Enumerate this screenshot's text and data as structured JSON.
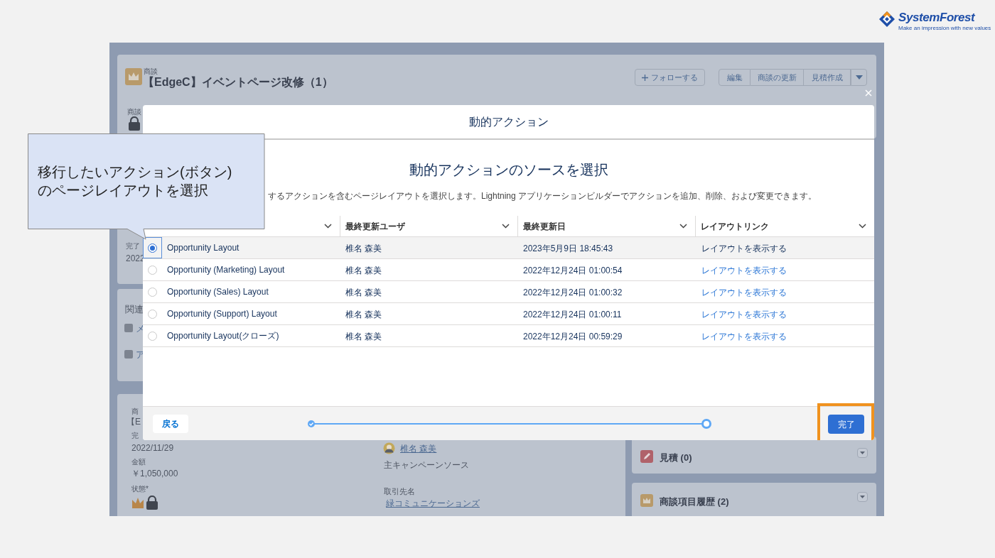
{
  "logo": {
    "name": "SystemForest",
    "tagline": "Make an impression with new values"
  },
  "background_page": {
    "object_label": "商談",
    "record_title": "【EdgeC】イベントページ改修（1）",
    "follow_button": "フォローする",
    "actions": [
      "編集",
      "商談の更新",
      "見積作成"
    ],
    "fragments": [
      "商談",
      "完了",
      "2022",
      "関連",
      "メ",
      "ア",
      "商",
      "【E",
      "完"
    ],
    "fields": [
      {
        "value": "2022/11/29"
      },
      {
        "label": "金額",
        "value": "￥1,050,000"
      },
      {
        "label": "状態*"
      }
    ],
    "owner": "椎名 森美",
    "campaign_label": "主キャンペーンソース",
    "account_label": "取引先名",
    "account": "緑コミュニケーションズ",
    "related": [
      "見積 (0)",
      "商談項目履歴 (2)"
    ]
  },
  "modal": {
    "title": "動的アクション",
    "heading": "動的アクションのソースを選択",
    "description": "するアクションを含むページレイアウトを選択します。Lightning アプリケーションビルダーでアクションを追加、削除、および変更できます。",
    "columns": [
      "最終更新ユーザ",
      "最終更新日",
      "レイアウトリンク"
    ],
    "rows": [
      {
        "name": "Opportunity Layout",
        "user": "椎名 森美",
        "date": "2023年5月9日 18:45:43",
        "link": "レイアウトを表示する",
        "selected": true
      },
      {
        "name": "Opportunity (Marketing) Layout",
        "user": "椎名 森美",
        "date": "2022年12月24日 01:00:54",
        "link": "レイアウトを表示する",
        "selected": false
      },
      {
        "name": "Opportunity (Sales) Layout",
        "user": "椎名 森美",
        "date": "2022年12月24日 01:00:32",
        "link": "レイアウトを表示する",
        "selected": false
      },
      {
        "name": "Opportunity (Support) Layout",
        "user": "椎名 森美",
        "date": "2022年12月24日 01:00:11",
        "link": "レイアウトを表示する",
        "selected": false
      },
      {
        "name": "Opportunity Layout(クローズ)",
        "user": "椎名 森美",
        "date": "2022年12月24日 00:59:29",
        "link": "レイアウトを表示する",
        "selected": false
      }
    ],
    "back_button": "戻る",
    "finish_button": "完了"
  },
  "callout": {
    "text": "移行したいアクション(ボタン)\nのページレイアウトを選択"
  }
}
